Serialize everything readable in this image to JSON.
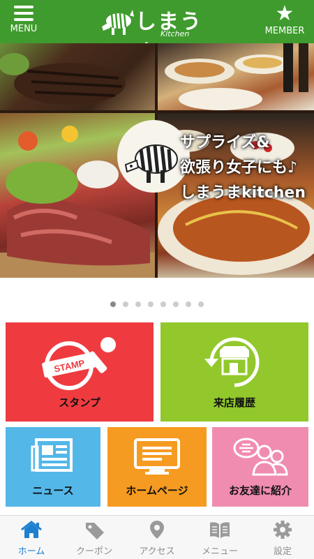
{
  "header": {
    "menu_label": "MENU",
    "brand_title": "しまうま",
    "brand_sub": "Kitchen",
    "member_label": "MEMBER",
    "color": "#3f9b2d"
  },
  "hero": {
    "line1": "サプライズ&",
    "line2": "欲張り女子にも♪",
    "line3": "しまうまkitchen"
  },
  "carousel": {
    "count": 8,
    "active_index": 0
  },
  "tiles": [
    {
      "id": "stamp",
      "label": "スタンプ",
      "color": "#ef3b3f",
      "icon": "stamp-icon"
    },
    {
      "id": "history",
      "label": "来店履歴",
      "color": "#92c82c",
      "icon": "store-history-icon"
    },
    {
      "id": "news",
      "label": "ニュース",
      "color": "#53b7e8",
      "icon": "newspaper-icon"
    },
    {
      "id": "homepage",
      "label": "ホームページ",
      "color": "#f69b21",
      "icon": "monitor-icon"
    },
    {
      "id": "friend",
      "label": "お友達に紹介",
      "color": "#f08cb0",
      "icon": "friends-chat-icon"
    }
  ],
  "tabbar": {
    "items": [
      {
        "label": "ホーム",
        "icon": "home-icon",
        "active": true
      },
      {
        "label": "クーポン",
        "icon": "tag-icon",
        "active": false
      },
      {
        "label": "アクセス",
        "icon": "map-pin-icon",
        "active": false
      },
      {
        "label": "メニュー",
        "icon": "book-icon",
        "active": false
      },
      {
        "label": "設定",
        "icon": "gear-icon",
        "active": false
      }
    ],
    "active_color": "#1d7fd0",
    "inactive_color": "#8c8c8c"
  }
}
